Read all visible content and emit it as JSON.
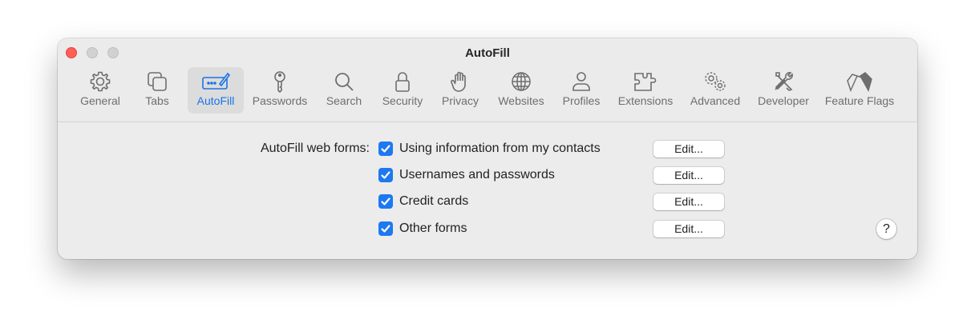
{
  "window": {
    "title": "AutoFill"
  },
  "toolbar": {
    "items": [
      {
        "label": "General",
        "icon": "gear-icon"
      },
      {
        "label": "Tabs",
        "icon": "tabs-icon"
      },
      {
        "label": "AutoFill",
        "icon": "autofill-icon",
        "active": true
      },
      {
        "label": "Passwords",
        "icon": "key-icon"
      },
      {
        "label": "Search",
        "icon": "magnifier-icon"
      },
      {
        "label": "Security",
        "icon": "lock-icon"
      },
      {
        "label": "Privacy",
        "icon": "hand-icon"
      },
      {
        "label": "Websites",
        "icon": "globe-icon"
      },
      {
        "label": "Profiles",
        "icon": "person-icon"
      },
      {
        "label": "Extensions",
        "icon": "puzzle-icon"
      },
      {
        "label": "Advanced",
        "icon": "gears-icon"
      },
      {
        "label": "Developer",
        "icon": "tools-icon"
      },
      {
        "label": "Feature Flags",
        "icon": "flags-icon"
      }
    ]
  },
  "autofill": {
    "section_label": "AutoFill web forms:",
    "options": [
      {
        "label": "Using information from my contacts",
        "checked": true,
        "button": "Edit..."
      },
      {
        "label": "Usernames and passwords",
        "checked": true,
        "button": "Edit..."
      },
      {
        "label": "Credit cards",
        "checked": true,
        "button": "Edit..."
      },
      {
        "label": "Other forms",
        "checked": true,
        "button": "Edit..."
      }
    ]
  },
  "help": {
    "label": "?"
  },
  "colors": {
    "accent": "#1e78f0",
    "close": "#ff5f57",
    "active_label": "#1a73e8"
  }
}
